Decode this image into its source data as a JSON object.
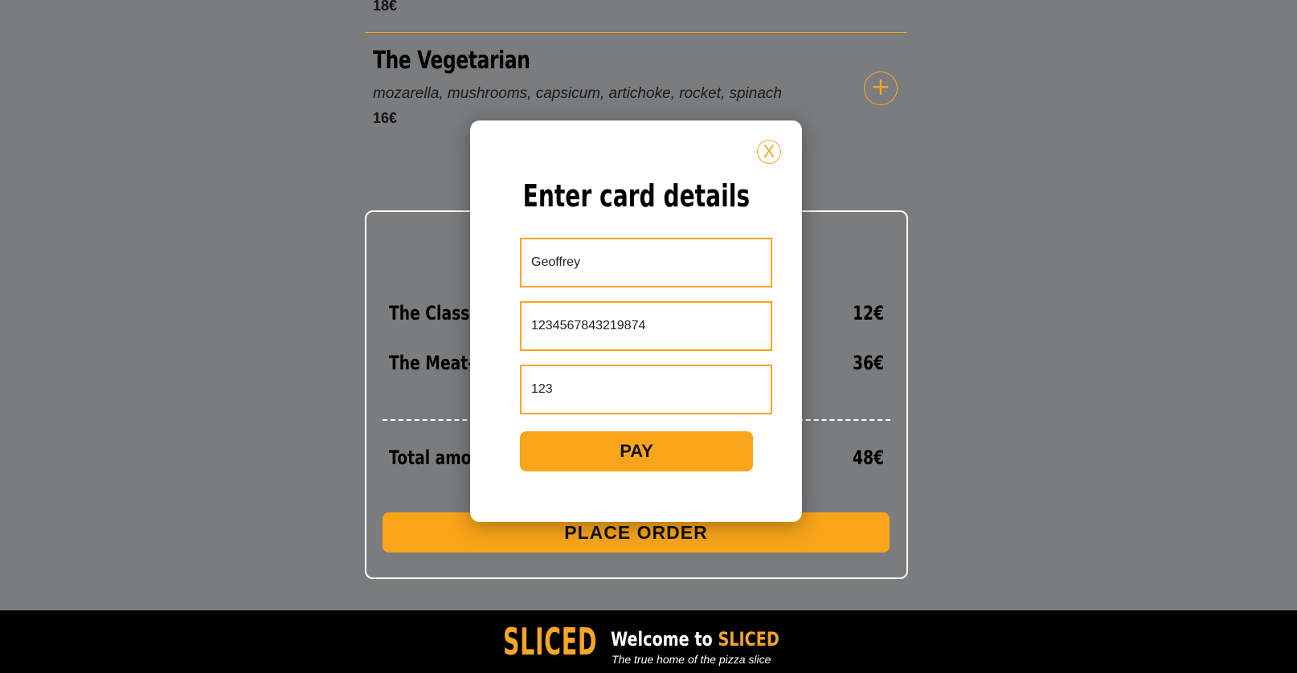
{
  "menu": {
    "previous_item_price": "18€",
    "item": {
      "name": "The Vegetarian",
      "description": "mozarella, mushrooms, capsicum, artichoke, rocket, spinach",
      "price": "16€",
      "add_icon": "+"
    }
  },
  "order": {
    "rows": [
      {
        "label": "The Classic",
        "price": "12€"
      },
      {
        "label": "The Meat-L",
        "price": "36€"
      }
    ],
    "total_label": "Total amou",
    "total_value": "48€",
    "place_order_label": "PLACE ORDER"
  },
  "modal": {
    "close_icon": "X",
    "title": "Enter card details",
    "fields": {
      "name": "Geoffrey",
      "card_number": "1234567843219874",
      "cvv": "123"
    },
    "pay_label": "PAY"
  },
  "footer": {
    "logo_text": "SLICED",
    "welcome_prefix": "Welcome to ",
    "welcome_brand": "SLICED",
    "tagline": "The true home of the pizza slice"
  },
  "colors": {
    "accent": "#f9a51a",
    "overlay_background": "#7b7c7e",
    "footer_background": "#000000"
  },
  "icons": {
    "add": "plus-icon",
    "close": "close-icon"
  }
}
